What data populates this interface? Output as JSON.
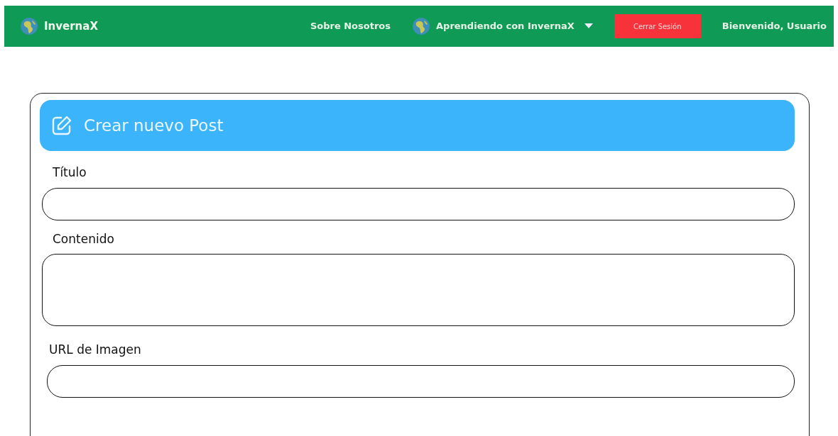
{
  "navbar": {
    "brand": "InvernaX",
    "links": [
      {
        "kind": "link",
        "label": "Sobre Nosotros"
      },
      {
        "kind": "dropdown",
        "label": "Aprendiendo con InvernaX"
      }
    ],
    "logout_button": "Cerrar Sesión",
    "greeting": "Bienvenido, Usuario"
  },
  "form": {
    "title": "Crear nuevo Post",
    "fields": [
      {
        "label": "Título",
        "kind": "input"
      },
      {
        "label": "Contenido",
        "kind": "textarea"
      },
      {
        "label": "URL de Imagen",
        "kind": "input"
      }
    ]
  }
}
